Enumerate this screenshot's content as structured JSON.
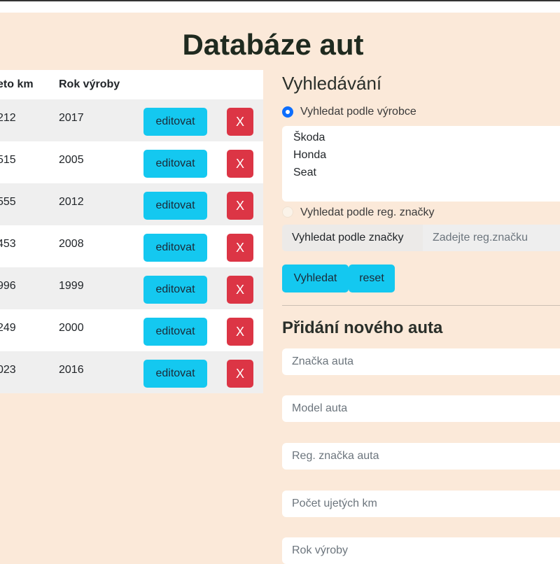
{
  "page": {
    "title": "Databáze aut"
  },
  "table": {
    "headers": {
      "km": "eto km",
      "year": "Rok výroby"
    },
    "rows": [
      {
        "km": "212",
        "year": "2017"
      },
      {
        "km": "515",
        "year": "2005"
      },
      {
        "km": "555",
        "year": "2012"
      },
      {
        "km": "453",
        "year": "2008"
      },
      {
        "km": "996",
        "year": "1999"
      },
      {
        "km": "249",
        "year": "2000"
      },
      {
        "km": "023",
        "year": "2016"
      }
    ],
    "edit_label": "editovat",
    "delete_label": "X"
  },
  "search": {
    "heading": "Vyhledávání",
    "by_maker_label": "Vyhledat podle výrobce",
    "makers": [
      "Škoda",
      "Honda",
      "Seat"
    ],
    "by_plate_label": "Vyhledat podle reg. značky",
    "plate_addon": "Vyhledat podle značky",
    "plate_placeholder": "Zadejte reg.značku",
    "search_button": "Vyhledat",
    "reset_button": "reset"
  },
  "add": {
    "heading": "Přidání nového auta",
    "brand_placeholder": "Značka auta",
    "model_placeholder": "Model auta",
    "plate_placeholder": "Reg. značka auta",
    "km_placeholder": "Počet ujetých km",
    "year_placeholder": "Rok výroby"
  },
  "colors": {
    "background": "#fbe9d9",
    "cyan": "#14c8f0",
    "danger": "#dc3545",
    "radio": "#0d6efd"
  }
}
